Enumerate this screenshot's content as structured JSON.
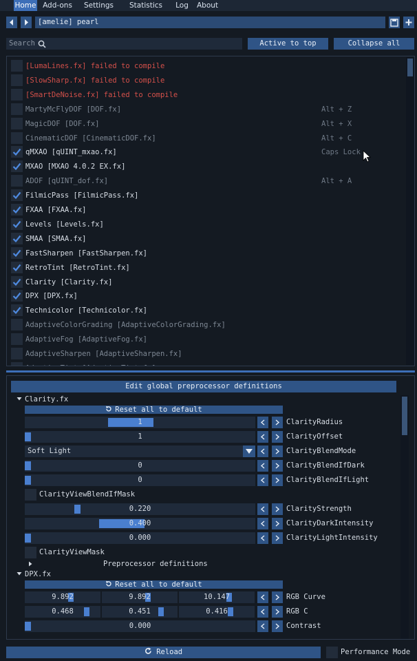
{
  "menu": {
    "items": [
      {
        "label": "Home",
        "active": true
      },
      {
        "label": "Add-ons"
      },
      {
        "label": "Settings"
      },
      {
        "label": "Statistics"
      },
      {
        "label": "Log"
      },
      {
        "label": "About"
      }
    ]
  },
  "preset": {
    "name": "[amelie] pearl"
  },
  "toolbar": {
    "search_placeholder": "Search",
    "active_to_top_label": "Active to top",
    "collapse_all_label": "Collapse all"
  },
  "effects": [
    {
      "label": "[LumaLines.fx] failed to compile",
      "state": "error",
      "key": ""
    },
    {
      "label": "[SlowSharp.fx] failed to compile",
      "state": "error",
      "key": ""
    },
    {
      "label": "[SmartDeNoise.fx] failed to compile",
      "state": "error",
      "key": ""
    },
    {
      "label": "MartyMcFlyDOF [DOF.fx]",
      "state": "off",
      "key": "Alt + Z"
    },
    {
      "label": "MagicDOF [DOF.fx]",
      "state": "off",
      "key": "Alt + X"
    },
    {
      "label": "CinematicDOF [CinematicDOF.fx]",
      "state": "off",
      "key": "Alt + C"
    },
    {
      "label": "qMXAO [qUINT_mxao.fx]",
      "state": "on",
      "key": "Caps Lock"
    },
    {
      "label": "MXAO [MXAO 4.0.2 EX.fx]",
      "state": "on",
      "key": ""
    },
    {
      "label": "ADOF [qUINT_dof.fx]",
      "state": "off",
      "key": "Alt + A"
    },
    {
      "label": "FilmicPass [FilmicPass.fx]",
      "state": "on",
      "key": ""
    },
    {
      "label": "FXAA [FXAA.fx]",
      "state": "on",
      "key": ""
    },
    {
      "label": "Levels [Levels.fx]",
      "state": "on",
      "key": ""
    },
    {
      "label": "SMAA [SMAA.fx]",
      "state": "on",
      "key": ""
    },
    {
      "label": "FastSharpen [FastSharpen.fx]",
      "state": "on",
      "key": ""
    },
    {
      "label": "RetroTint [RetroTint.fx]",
      "state": "on",
      "key": ""
    },
    {
      "label": "Clarity [Clarity.fx]",
      "state": "on",
      "key": ""
    },
    {
      "label": "DPX [DPX.fx]",
      "state": "on",
      "key": ""
    },
    {
      "label": "Technicolor [Technicolor.fx]",
      "state": "on",
      "key": ""
    },
    {
      "label": "AdaptiveColorGrading [AdaptiveColorGrading.fx]",
      "state": "off",
      "key": ""
    },
    {
      "label": "AdaptiveFog [AdaptiveFog.fx]",
      "state": "off",
      "key": ""
    },
    {
      "label": "AdaptiveSharpen [AdaptiveSharpen.fx]",
      "state": "off",
      "key": ""
    },
    {
      "label": "AdaptiveTint [AdaptiveTint.fx]",
      "state": "off",
      "key": ""
    }
  ],
  "settings": {
    "global_defs_label": "Edit global preprocessor definitions",
    "reset_label": "Reset all to default",
    "clarity": {
      "header": "Clarity.fx",
      "params": [
        {
          "kind": "slider",
          "value": "1",
          "fill": 0.45,
          "label": "ClarityRadius"
        },
        {
          "kind": "slider",
          "value": "1",
          "fill": 0.0,
          "label": "ClarityOffset"
        },
        {
          "kind": "combo",
          "value": "Soft Light",
          "label": "ClarityBlendMode"
        },
        {
          "kind": "slider",
          "value": "0",
          "fill": 0.0,
          "label": "ClarityBlendIfDark"
        },
        {
          "kind": "slider",
          "value": "0",
          "fill": 0.0,
          "label": "ClarityBlendIfLight"
        },
        {
          "kind": "check",
          "label": "ClarityViewBlendIfMask"
        },
        {
          "kind": "slider",
          "value": "0.220",
          "fill": 0.22,
          "label": "ClarityStrength"
        },
        {
          "kind": "slider",
          "value": "0.400",
          "fill": 0.4,
          "label": "ClarityDarkIntensity"
        },
        {
          "kind": "slider",
          "value": "0.000",
          "fill": 0.0,
          "label": "ClarityLightIntensity"
        },
        {
          "kind": "check",
          "label": "ClarityViewMask"
        }
      ],
      "preprocessor_label": "Preprocessor definitions"
    },
    "dpx": {
      "header": "DPX.fx",
      "params": [
        {
          "kind": "triple",
          "values": [
            "9.892",
            "9.892",
            "10.147"
          ],
          "fills": [
            0.62,
            0.62,
            0.68
          ],
          "label": "RGB Curve"
        },
        {
          "kind": "triple",
          "values": [
            "0.468",
            "0.451",
            "0.416"
          ],
          "fills": [
            0.84,
            0.8,
            0.7
          ],
          "label": "RGB C"
        },
        {
          "kind": "slider",
          "value": "0.000",
          "fill": 0.0,
          "label": "Contrast"
        }
      ]
    }
  },
  "footer": {
    "reload_label": "Reload",
    "performance_mode_label": "Performance Mode"
  },
  "colors": {
    "accent": "#3d6fb8",
    "error": "#d3504a"
  }
}
